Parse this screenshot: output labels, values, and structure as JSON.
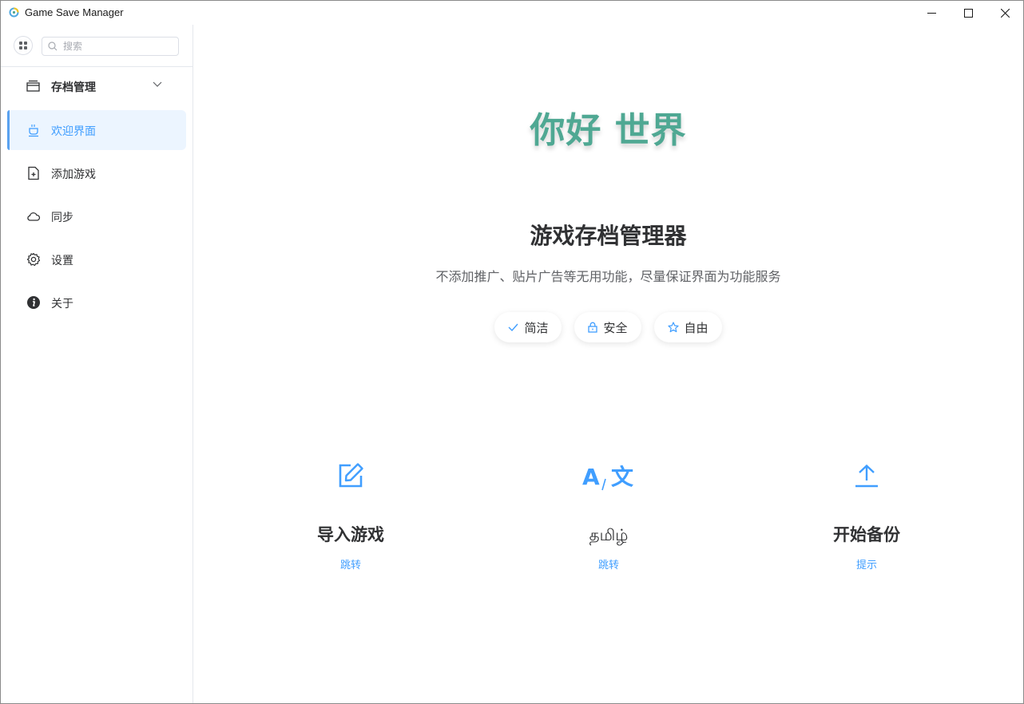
{
  "window": {
    "title": "Game Save Manager"
  },
  "search": {
    "placeholder": "搜索"
  },
  "sidebar": {
    "group": {
      "label": "存档管理",
      "icon": "archive-icon"
    },
    "items": [
      {
        "label": "欢迎界面",
        "icon": "coffee-cup-icon",
        "active": true
      },
      {
        "label": "添加游戏",
        "icon": "add-document-icon"
      },
      {
        "label": "同步",
        "icon": "cloud-icon"
      },
      {
        "label": "设置",
        "icon": "gear-icon"
      },
      {
        "label": "关于",
        "icon": "info-icon"
      }
    ]
  },
  "main": {
    "hero": "你好 世界",
    "subtitle": "游戏存档管理器",
    "description": "不添加推广、贴片广告等无用功能，尽量保证界面为功能服务",
    "tags": [
      {
        "label": "简洁",
        "icon": "check-icon"
      },
      {
        "label": "安全",
        "icon": "lock-icon"
      },
      {
        "label": "自由",
        "icon": "star-icon"
      }
    ],
    "features": [
      {
        "title": "导入游戏",
        "link": "跳转",
        "icon": "edit-icon"
      },
      {
        "title": "தமிழ்",
        "link": "跳转",
        "icon": "translate-icon"
      },
      {
        "title": "开始备份",
        "link": "提示",
        "icon": "upload-icon"
      }
    ]
  },
  "colors": {
    "accent": "#409eff",
    "hero": "#4fa893",
    "active_bg": "#ecf5ff"
  }
}
